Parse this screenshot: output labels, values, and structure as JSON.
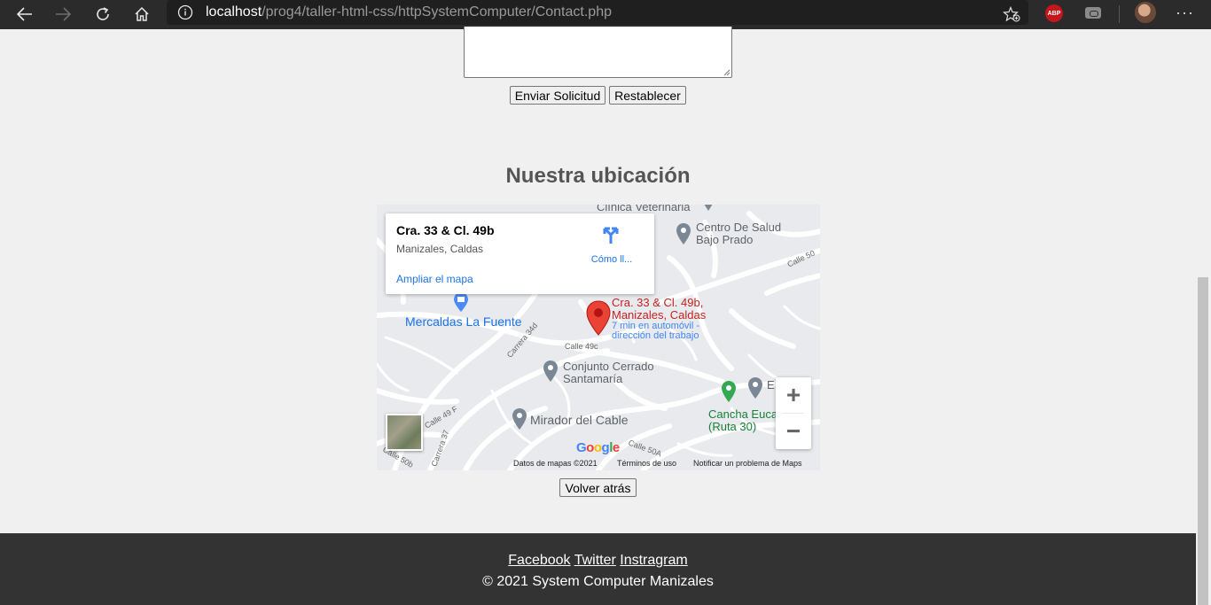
{
  "browser": {
    "url_host": "localhost",
    "url_path": "/prog4/taller-html-css/httpSystemComputer/Contact.php",
    "abp_label": "ABP",
    "more_label": "···"
  },
  "form": {
    "submit_label": "Enviar Solicitud",
    "reset_label": "Restablecer"
  },
  "location": {
    "heading": "Nuestra ubicación"
  },
  "map": {
    "info_title": "Cra. 33 & Cl. 49b",
    "info_subtitle": "Manizales, Caldas",
    "info_directions": "Cómo ll...",
    "info_expand": "Ampliar el mapa",
    "pin_label_1": "Cra. 33 & Cl. 49b,",
    "pin_label_2": "Manizales, Caldas",
    "pin_eta_1": "7 min en automóvil -",
    "pin_eta_2": "dirección del trabajo",
    "places": {
      "clinica": "Clínica Veterinaria",
      "centro_salud_1": "Centro De Salud",
      "centro_salud_2": "Bajo Prado",
      "mercaldas": "Mercaldas La Fuente",
      "conjunto_1": "Conjunto Cerrado",
      "conjunto_2": "Santamaría",
      "mirador": "Mirador del Cable",
      "cancha_1": "Cancha Euca",
      "cancha_2": "(Ruta 30)",
      "edificio": "E"
    },
    "streets": {
      "calle50": "Calle 50",
      "calle49c": "Calle 49c",
      "carrera34d": "Carrera 34d",
      "calle50a": "Calle 50A",
      "calle49f": "Calle 49 F",
      "carrera37": "Carrera 37",
      "calle50b": "Calle 50b"
    },
    "attrib_data": "Datos de mapas ©2021",
    "attrib_terms": "Términos de uso",
    "attrib_report": "Notificar un problema de Maps",
    "zoom_in": "+",
    "zoom_out": "−"
  },
  "back_label": "Volver atrás",
  "footer": {
    "facebook": "Facebook",
    "twitter": "Twitter",
    "instagram": "Instragram",
    "copyright": "© 2021 System Computer Manizales"
  }
}
